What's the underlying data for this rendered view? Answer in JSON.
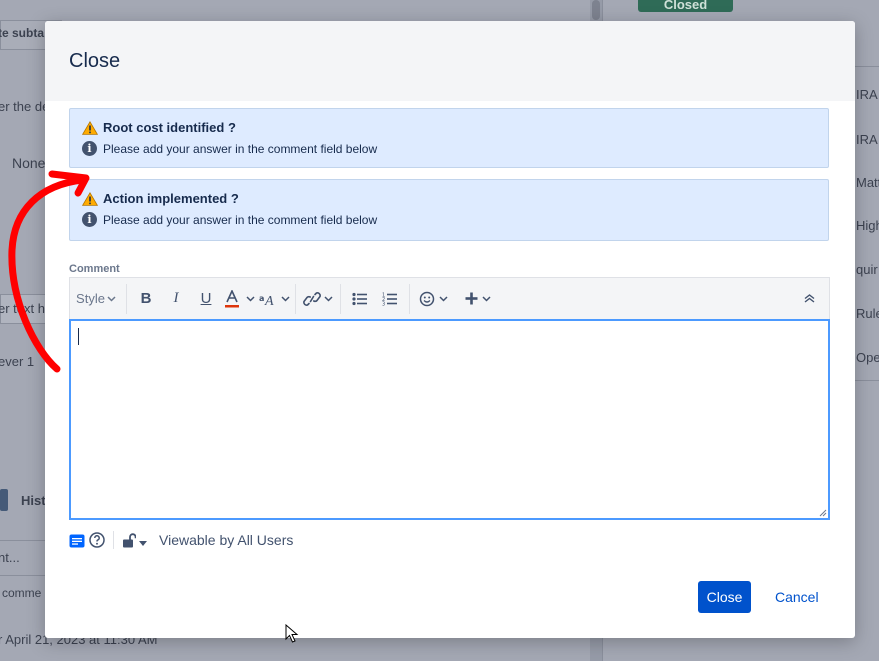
{
  "modal": {
    "title": "Close",
    "notices": [
      {
        "title": "Root cost identified ?",
        "description": "Please add your answer in the comment field below"
      },
      {
        "title": "Action implemented ?",
        "description": "Please add your answer in the comment field below"
      }
    ],
    "comment_label": "Comment",
    "toolbar": {
      "style_label": "Style",
      "icons": [
        "bold-icon",
        "italic-icon",
        "underline-icon",
        "text-color-icon",
        "text-effects-icon",
        "link-icon",
        "bullet-list-icon",
        "numbered-list-icon",
        "emoji-icon",
        "insert-more-icon",
        "collapse-toolbar-icon"
      ]
    },
    "comment_value": "",
    "visibility_label": "Viewable by All Users",
    "buttons": {
      "close": "Close",
      "cancel": "Cancel"
    }
  },
  "background": {
    "left_texts": [
      "te subta",
      "er the de",
      "None",
      "er text h",
      "ever 1",
      "Hist",
      "nt...",
      "comme",
      "r  April 21, 2023 at 11:30 AM"
    ],
    "right_texts": [
      "IRA",
      "IRA",
      "Matt",
      "High",
      "quir",
      "Rule",
      "Oper"
    ],
    "closed_badge": "Closed"
  },
  "colors": {
    "primary": "#0052cc",
    "notice_bg": "#deebff",
    "editor_focus": "#4c9aff",
    "annotation_arrow": "#ff0000"
  }
}
